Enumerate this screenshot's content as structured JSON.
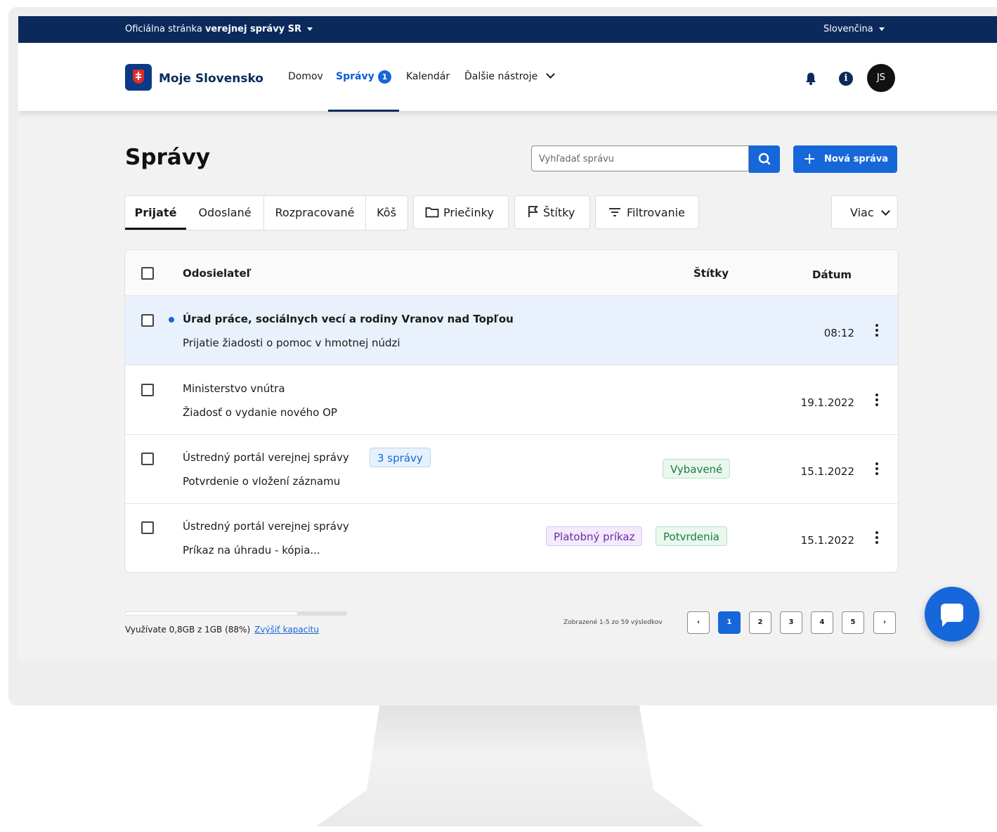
{
  "gov_bar": {
    "prefix": "Oficiálna stránka",
    "bold": "verejnej správy SR",
    "language": "Slovenčina"
  },
  "header": {
    "brand": "Moje Slovensko",
    "nav": {
      "home": "Domov",
      "messages": "Správy",
      "messages_badge": "1",
      "calendar": "Kalendár",
      "more_tools": "Ďalšie nástroje"
    },
    "avatar_initials": "JS"
  },
  "main": {
    "title": "Správy",
    "search_placeholder": "Vyhľadať správu",
    "new_message": "Nová správa",
    "tabs": [
      "Prijaté",
      "Odoslané",
      "Rozpracované",
      "Kôš"
    ],
    "tools": {
      "folders": "Priečinky",
      "tags": "Štítky",
      "filter": "Filtrovanie",
      "more": "Viac"
    }
  },
  "table": {
    "headers": {
      "sender": "Odosielateľ",
      "tags": "Štítky",
      "date": "Dátum"
    },
    "rows": [
      {
        "sender": "Úrad práce, sociálnych vecí a rodiny Vranov nad Topľou",
        "subject": "Prijatie žiadosti o pomoc v hmotnej núdzi",
        "date": "08:12"
      },
      {
        "sender": "Ministerstvo vnútra",
        "subject": "Žiadosť o vydanie nového OP",
        "date": "19.1.2022"
      },
      {
        "sender": "Ústredný portál verejnej správy",
        "count": "3 správy",
        "subject": "Potvrdenie o vložení záznamu",
        "tag1": "Vybavené",
        "date": "15.1.2022"
      },
      {
        "sender": "Ústredný portál verejnej správy",
        "subject": "Príkaz na úhradu - kópia...",
        "tag1": "Platobný príkaz",
        "tag2": "Potvrdenia",
        "date": "15.1.2022"
      }
    ]
  },
  "footer": {
    "storage_text": "Využívate 0,8GB z 1GB (88%)",
    "storage_link": "Zvýšiť kapacitu",
    "storage_used_fraction": 0.78,
    "results": "Zobrazené 1-5 zo 59 výsledkov",
    "pages": [
      "1",
      "2",
      "3",
      "4",
      "5"
    ]
  },
  "colors": {
    "primary": "#1667d9",
    "navy": "#0b2a5b"
  }
}
